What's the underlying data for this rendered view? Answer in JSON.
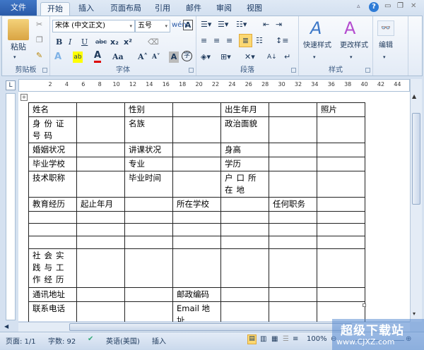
{
  "tabs": {
    "file": "文件",
    "home": "开始",
    "insert": "插入",
    "layout": "页面布局",
    "references": "引用",
    "mailings": "邮件",
    "review": "审阅",
    "view": "视图"
  },
  "ribbon": {
    "clipboard": {
      "label": "剪贴板",
      "paste": "粘贴"
    },
    "font": {
      "label": "字体",
      "font_name": "宋体 (中文正文)",
      "font_size": "五号",
      "bold": "B",
      "italic": "I",
      "underline": "U",
      "strike": "abc",
      "sub": "x₂",
      "sup": "x²",
      "grow": "A˄",
      "shrink": "A˅",
      "case": "Aa"
    },
    "paragraph": {
      "label": "段落"
    },
    "styles": {
      "label": "样式",
      "quick": "快速样式",
      "change": "更改样式"
    },
    "editing": {
      "label": "编辑"
    }
  },
  "ruler": {
    "numbers": [
      "2",
      "4",
      "6",
      "8",
      "10",
      "12",
      "14",
      "16",
      "18",
      "20",
      "22",
      "24",
      "26",
      "28",
      "30",
      "32",
      "34",
      "36",
      "38",
      "40",
      "42",
      "44"
    ]
  },
  "table": {
    "rows": [
      [
        "姓名",
        "",
        "性别",
        "",
        "出生年月",
        "",
        "照片"
      ],
      [
        "身份证号码",
        "",
        "名族",
        "",
        "政治面貌",
        "",
        ""
      ],
      [
        "婚姻状况",
        "",
        "讲课状况",
        "",
        "身高",
        "",
        ""
      ],
      [
        "毕业学校",
        "",
        "专业",
        "",
        "学历",
        "",
        ""
      ],
      [
        "技术职称",
        "",
        "毕业时间",
        "",
        "户口所在地",
        "",
        ""
      ],
      [
        "教育经历",
        "起止年月",
        "",
        "所在学校",
        "",
        "任何职务",
        ""
      ],
      [
        "",
        "",
        "",
        "",
        "",
        "",
        ""
      ],
      [
        "",
        "",
        "",
        "",
        "",
        "",
        ""
      ],
      [
        "",
        "",
        "",
        "",
        "",
        "",
        ""
      ],
      [
        "社会实践与工作经历",
        "",
        "",
        "",
        "",
        "",
        ""
      ],
      [
        "通讯地址",
        "",
        "",
        "邮政编码",
        "",
        "",
        ""
      ],
      [
        "联系电话",
        "",
        "",
        "Email 地址",
        "",
        "",
        ""
      ]
    ]
  },
  "status": {
    "page": "页面: 1/1",
    "words": "字数: 92",
    "language": "英语(美国)",
    "mode": "插入",
    "zoom": "100%"
  },
  "watermark": {
    "title": "超级下载站",
    "url": "www.CJXZ.com"
  }
}
